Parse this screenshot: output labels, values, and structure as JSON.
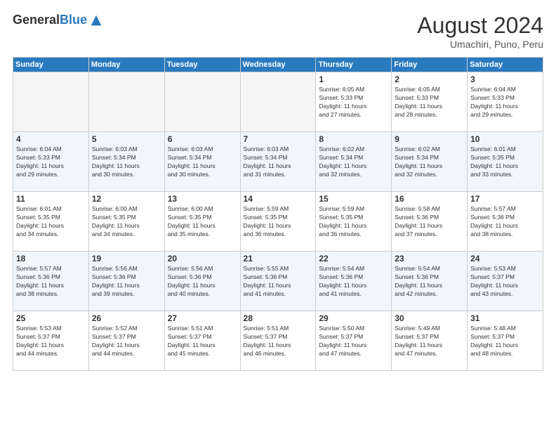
{
  "logo": {
    "general": "General",
    "blue": "Blue"
  },
  "header": {
    "month": "August 2024",
    "location": "Umachiri, Puno, Peru"
  },
  "days_of_week": [
    "Sunday",
    "Monday",
    "Tuesday",
    "Wednesday",
    "Thursday",
    "Friday",
    "Saturday"
  ],
  "weeks": [
    [
      {
        "day": "",
        "info": ""
      },
      {
        "day": "",
        "info": ""
      },
      {
        "day": "",
        "info": ""
      },
      {
        "day": "",
        "info": ""
      },
      {
        "day": "1",
        "info": "Sunrise: 6:05 AM\nSunset: 5:33 PM\nDaylight: 11 hours\nand 27 minutes."
      },
      {
        "day": "2",
        "info": "Sunrise: 6:05 AM\nSunset: 5:33 PM\nDaylight: 11 hours\nand 28 minutes."
      },
      {
        "day": "3",
        "info": "Sunrise: 6:04 AM\nSunset: 5:33 PM\nDaylight: 11 hours\nand 29 minutes."
      }
    ],
    [
      {
        "day": "4",
        "info": "Sunrise: 6:04 AM\nSunset: 5:33 PM\nDaylight: 11 hours\nand 29 minutes."
      },
      {
        "day": "5",
        "info": "Sunrise: 6:03 AM\nSunset: 5:34 PM\nDaylight: 11 hours\nand 30 minutes."
      },
      {
        "day": "6",
        "info": "Sunrise: 6:03 AM\nSunset: 5:34 PM\nDaylight: 11 hours\nand 30 minutes."
      },
      {
        "day": "7",
        "info": "Sunrise: 6:03 AM\nSunset: 5:34 PM\nDaylight: 11 hours\nand 31 minutes."
      },
      {
        "day": "8",
        "info": "Sunrise: 6:02 AM\nSunset: 5:34 PM\nDaylight: 11 hours\nand 32 minutes."
      },
      {
        "day": "9",
        "info": "Sunrise: 6:02 AM\nSunset: 5:34 PM\nDaylight: 11 hours\nand 32 minutes."
      },
      {
        "day": "10",
        "info": "Sunrise: 6:01 AM\nSunset: 5:35 PM\nDaylight: 11 hours\nand 33 minutes."
      }
    ],
    [
      {
        "day": "11",
        "info": "Sunrise: 6:01 AM\nSunset: 5:35 PM\nDaylight: 11 hours\nand 34 minutes."
      },
      {
        "day": "12",
        "info": "Sunrise: 6:00 AM\nSunset: 5:35 PM\nDaylight: 11 hours\nand 34 minutes."
      },
      {
        "day": "13",
        "info": "Sunrise: 6:00 AM\nSunset: 5:35 PM\nDaylight: 11 hours\nand 35 minutes."
      },
      {
        "day": "14",
        "info": "Sunrise: 5:59 AM\nSunset: 5:35 PM\nDaylight: 11 hours\nand 36 minutes."
      },
      {
        "day": "15",
        "info": "Sunrise: 5:59 AM\nSunset: 5:35 PM\nDaylight: 11 hours\nand 36 minutes."
      },
      {
        "day": "16",
        "info": "Sunrise: 5:58 AM\nSunset: 5:36 PM\nDaylight: 11 hours\nand 37 minutes."
      },
      {
        "day": "17",
        "info": "Sunrise: 5:57 AM\nSunset: 5:36 PM\nDaylight: 11 hours\nand 38 minutes."
      }
    ],
    [
      {
        "day": "18",
        "info": "Sunrise: 5:57 AM\nSunset: 5:36 PM\nDaylight: 11 hours\nand 38 minutes."
      },
      {
        "day": "19",
        "info": "Sunrise: 5:56 AM\nSunset: 5:36 PM\nDaylight: 11 hours\nand 39 minutes."
      },
      {
        "day": "20",
        "info": "Sunrise: 5:56 AM\nSunset: 5:36 PM\nDaylight: 11 hours\nand 40 minutes."
      },
      {
        "day": "21",
        "info": "Sunrise: 5:55 AM\nSunset: 5:36 PM\nDaylight: 11 hours\nand 41 minutes."
      },
      {
        "day": "22",
        "info": "Sunrise: 5:54 AM\nSunset: 5:36 PM\nDaylight: 11 hours\nand 41 minutes."
      },
      {
        "day": "23",
        "info": "Sunrise: 5:54 AM\nSunset: 5:36 PM\nDaylight: 11 hours\nand 42 minutes."
      },
      {
        "day": "24",
        "info": "Sunrise: 5:53 AM\nSunset: 5:37 PM\nDaylight: 11 hours\nand 43 minutes."
      }
    ],
    [
      {
        "day": "25",
        "info": "Sunrise: 5:53 AM\nSunset: 5:37 PM\nDaylight: 11 hours\nand 44 minutes."
      },
      {
        "day": "26",
        "info": "Sunrise: 5:52 AM\nSunset: 5:37 PM\nDaylight: 11 hours\nand 44 minutes."
      },
      {
        "day": "27",
        "info": "Sunrise: 5:51 AM\nSunset: 5:37 PM\nDaylight: 11 hours\nand 45 minutes."
      },
      {
        "day": "28",
        "info": "Sunrise: 5:51 AM\nSunset: 5:37 PM\nDaylight: 11 hours\nand 46 minutes."
      },
      {
        "day": "29",
        "info": "Sunrise: 5:50 AM\nSunset: 5:37 PM\nDaylight: 11 hours\nand 47 minutes."
      },
      {
        "day": "30",
        "info": "Sunrise: 5:49 AM\nSunset: 5:37 PM\nDaylight: 11 hours\nand 47 minutes."
      },
      {
        "day": "31",
        "info": "Sunrise: 5:48 AM\nSunset: 5:37 PM\nDaylight: 11 hours\nand 48 minutes."
      }
    ]
  ]
}
